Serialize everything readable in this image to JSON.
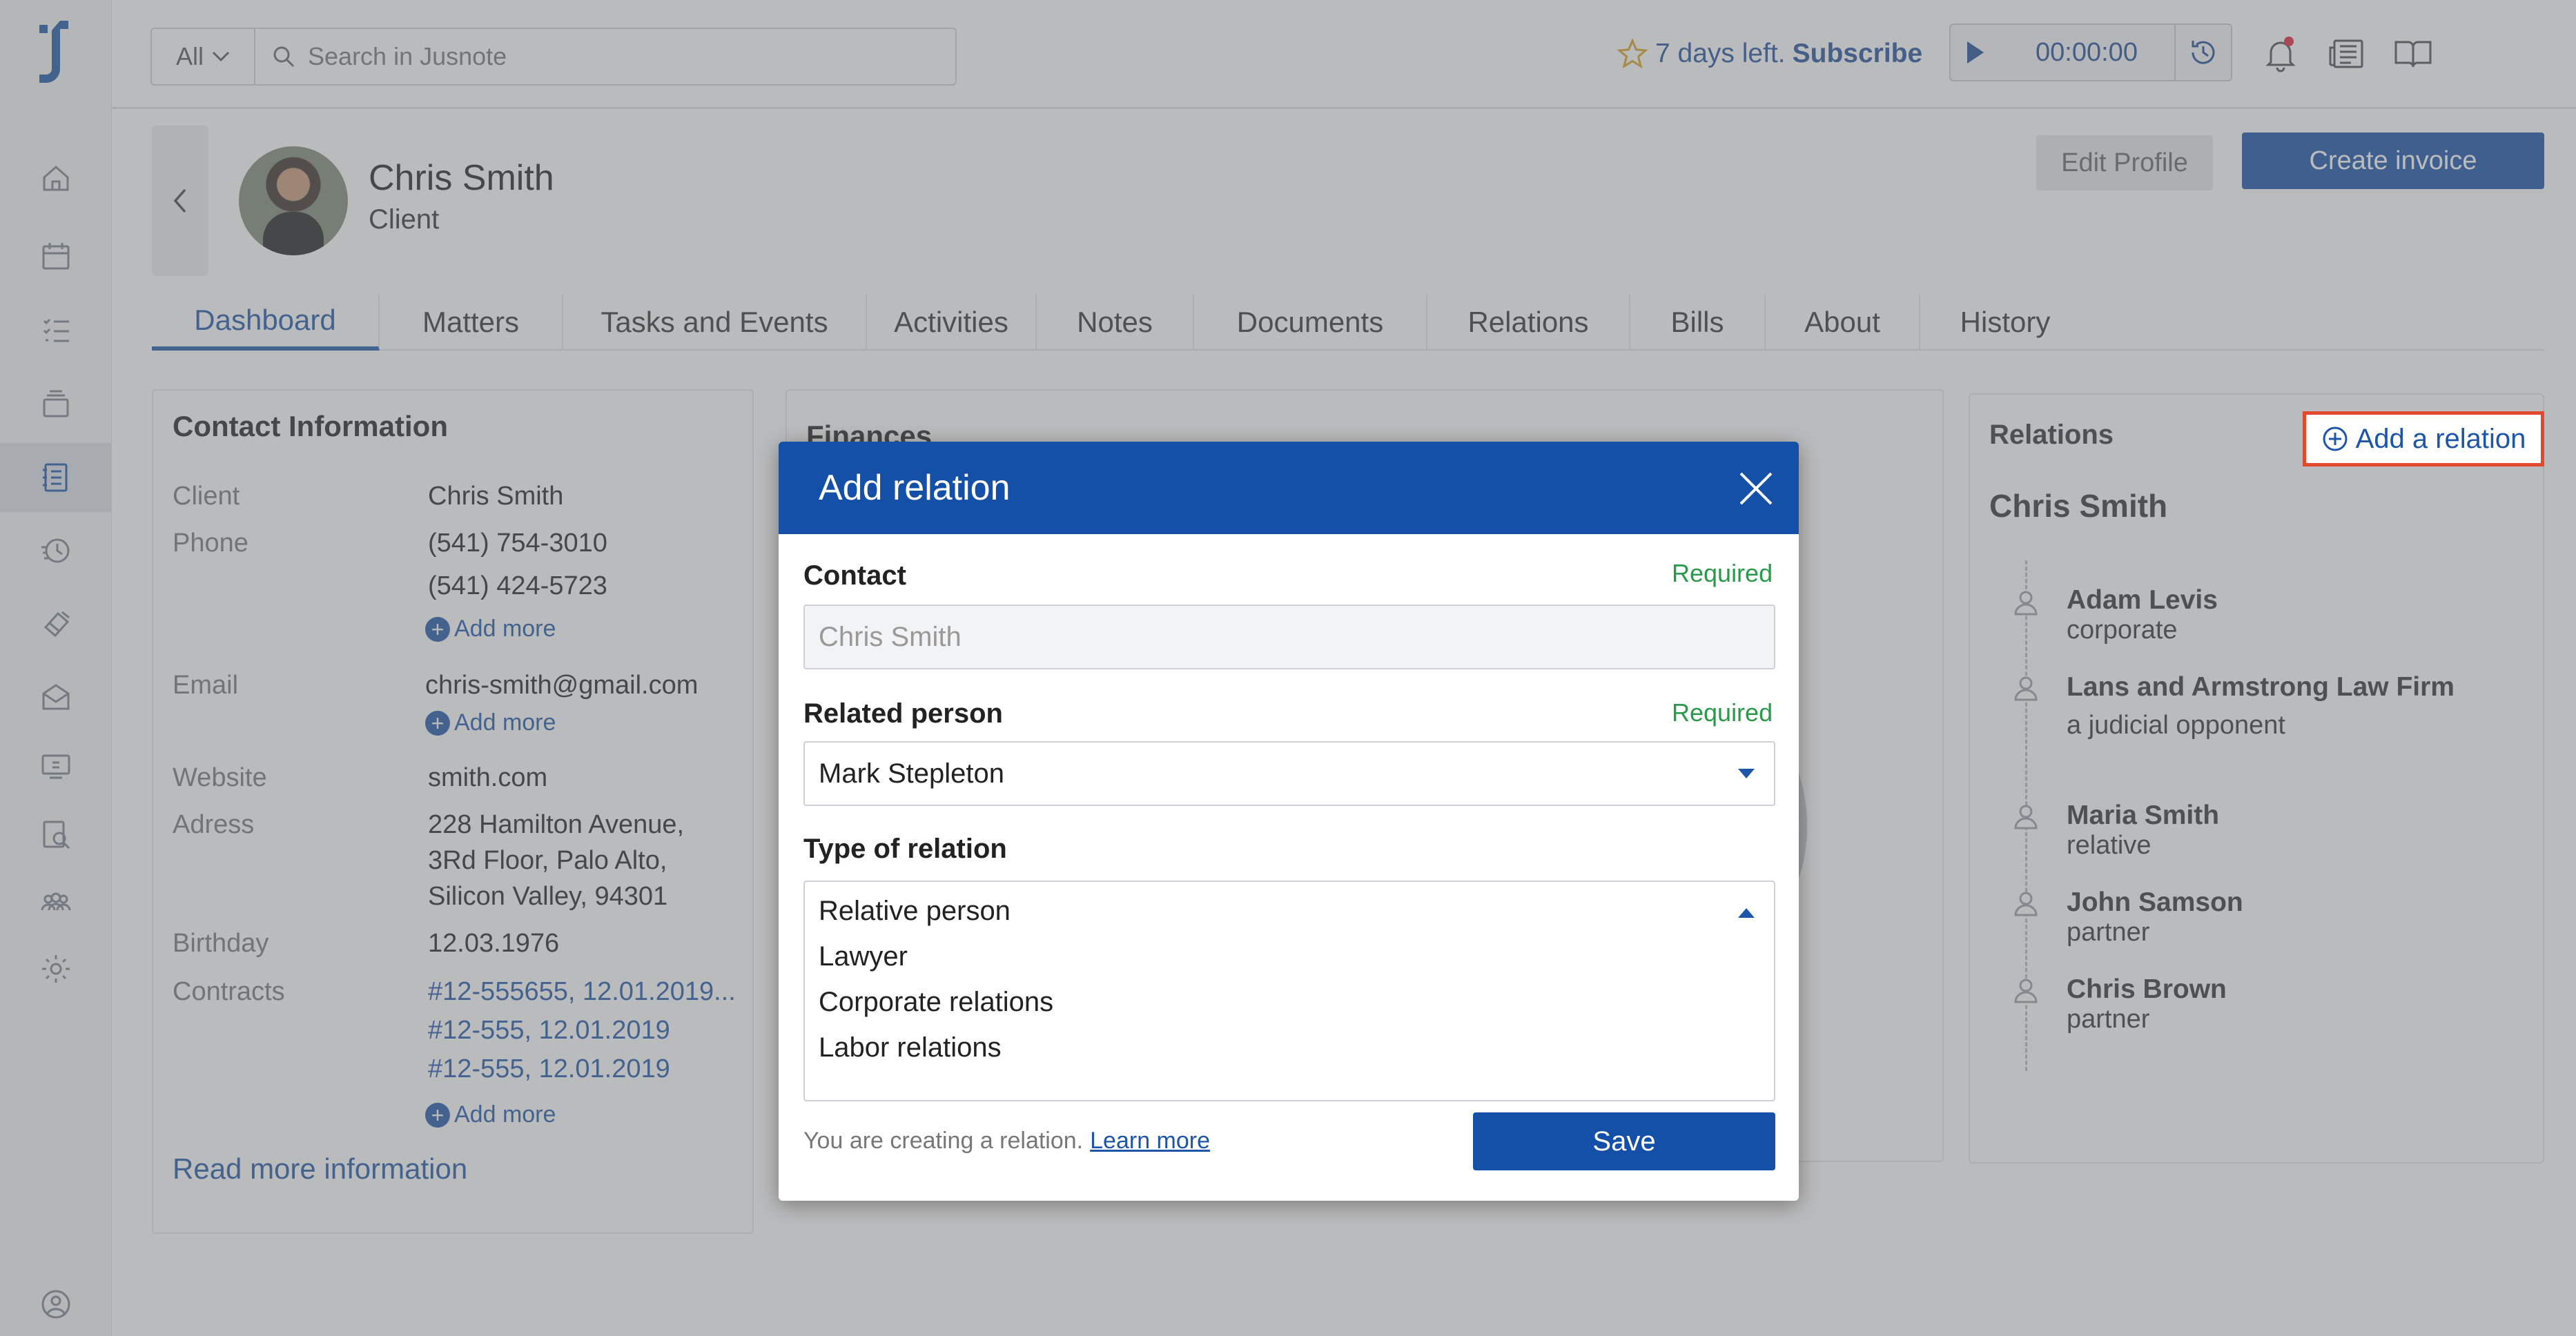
{
  "search": {
    "scope": "All",
    "placeholder": "Search in Jusnote"
  },
  "trial": {
    "days_text": "7 days left.",
    "subscribe": "Subscribe"
  },
  "timer": {
    "value": "00:00:00"
  },
  "profile": {
    "name": "Chris Smith",
    "role": "Client"
  },
  "actions": {
    "edit": "Edit Profile",
    "invoice": "Create invoice"
  },
  "tabs": [
    "Dashboard",
    "Matters",
    "Tasks and Events",
    "Activities",
    "Notes",
    "Documents",
    "Relations",
    "Bills",
    "About",
    "History"
  ],
  "contact": {
    "title": "Contact Information",
    "client_label": "Client",
    "client_value": "Chris Smith",
    "phone_label": "Phone",
    "phone_1": "(541) 754-3010",
    "phone_2": "(541) 424-5723",
    "add_more": "Add more",
    "email_label": "Email",
    "email_value": "chris-smith@gmail.com",
    "website_label": "Website",
    "website_value": "smith.com",
    "address_label": "Adress",
    "address_1": "228 Hamilton Avenue,",
    "address_2": "3Rd Floor, Palo Alto,",
    "address_3": "Silicon Valley, 94301",
    "birthday_label": "Birthday",
    "birthday_value": "12.03.1976",
    "contracts_label": "Contracts",
    "contract_1": "#12-555655, 12.01.2019...",
    "contract_2": "#12-555, 12.01.2019",
    "contract_3": "#12-555, 12.01.2019",
    "read_more": "Read more information"
  },
  "finances": {
    "title": "Finances"
  },
  "relations": {
    "title": "Relations",
    "add": "Add a relation",
    "person": "Chris Smith",
    "items": [
      {
        "name": "Adam Levis",
        "role": "corporate"
      },
      {
        "name": "Lans and Armstrong Law Firm",
        "role": "a judicial opponent"
      },
      {
        "name": "Maria Smith",
        "role": "relative"
      },
      {
        "name": "John Samson",
        "role": "partner"
      },
      {
        "name": "Chris Brown",
        "role": "partner"
      }
    ]
  },
  "modal": {
    "title": "Add relation",
    "contact_label": "Contact",
    "required": "Required",
    "contact_value": "Chris Smith",
    "related_label": "Related person",
    "related_value": "Mark Stepleton",
    "type_label": "Type of relation",
    "options": [
      "Relative person",
      "Lawyer",
      "Corporate relations",
      "Labor relations"
    ],
    "footer_text": "You are creating a relation.",
    "learn_more": "Learn more",
    "save": "Save"
  },
  "colors": {
    "primary": "#1450a8",
    "accent_green": "#2c9c54",
    "required_green": "#2a9a4a",
    "highlight": "#e24a2b"
  }
}
